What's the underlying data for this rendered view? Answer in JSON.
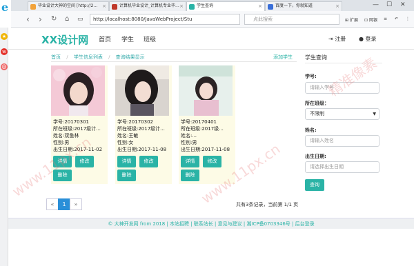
{
  "browser": {
    "tabs": [
      {
        "label": "毕业设计大神的空间 [http://2...",
        "active": false
      },
      {
        "label": "计算机毕业设计_计算机专业毕...",
        "active": false
      },
      {
        "label": "学生查询",
        "active": true
      },
      {
        "label": "百度一下，你就知道",
        "active": false
      }
    ],
    "url": "http://localhost:8080/JavaWebProject/Stu",
    "search_placeholder": "点此搜索",
    "ext_labels": [
      "扩展",
      "网银"
    ]
  },
  "header": {
    "logo": "XX设计网",
    "nav": [
      "首页",
      "学生",
      "班级"
    ],
    "register": "注册",
    "login": "登录"
  },
  "breadcrumb": {
    "items": [
      "首页",
      "/",
      "学生信息列表",
      "/",
      "查询结果显示"
    ],
    "add_link": "添加学生"
  },
  "students": [
    {
      "no": "学号:20170301",
      "class": "所在班级:2017级计...",
      "name": "姓名:双鱼林",
      "gender": "性别:男",
      "birthday": "出生日期:2017-11-02",
      "btn_detail": "详情",
      "btn_edit": "修改",
      "btn_delete": "删除"
    },
    {
      "no": "学号:20170302",
      "class": "所在班级:2017级计...",
      "name": "姓名:王敏",
      "gender": "性别:女",
      "birthday": "出生日期:2017-11-08",
      "btn_detail": "详情",
      "btn_edit": "修改",
      "btn_delete": "删除"
    },
    {
      "no": "学号:20170401",
      "class": "所在班级:2017级...",
      "name": "姓名:...",
      "gender": "性别:男",
      "birthday": "出生日期:2017-11-08",
      "btn_detail": "详情",
      "btn_edit": "修改",
      "btn_delete": "删除"
    }
  ],
  "pagination": {
    "prev": "«",
    "current": "1",
    "next": "»",
    "summary": "共有3条记录，当前第 1/1 页"
  },
  "footer": {
    "text": "© 大神开发网 from 2018 | 本站招聘 | 联系站长 | 意见与建议 | 湘ICP备0703346号 | 后台登录"
  },
  "query": {
    "title": "学生查询",
    "student_no_label": "学号:",
    "student_no_placeholder": "请输入学号",
    "class_label": "所在班级：",
    "class_value": "不限制",
    "name_label": "姓名:",
    "name_placeholder": "请输入姓名",
    "birthday_label": "出生日期:",
    "birthday_placeholder": "请选择出生日期",
    "submit": "查询"
  },
  "watermark": [
    "www.11px.cn",
    "www.11px.cn",
    "精准像素"
  ],
  "colors": {
    "accent": "#2ab3a6",
    "card_bg": "#fdfbe6",
    "page_active": "#2a8fd8"
  }
}
